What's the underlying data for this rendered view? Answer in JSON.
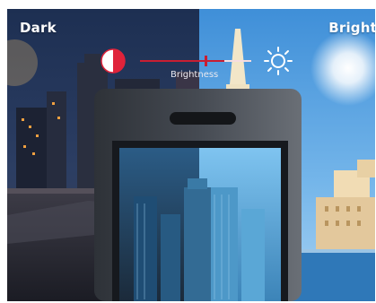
{
  "labels": {
    "dark": "Dark",
    "bright": "Bright",
    "brightness": "Brightness"
  },
  "brightness_slider": {
    "level_percent": 45
  },
  "icons": {
    "left": "contrast-half-circle-icon",
    "right": "sun-icon"
  },
  "colors": {
    "contrast_icon": "#e0233a",
    "slider_track": "#c81e32",
    "device_frame": "#3a3f46",
    "dark_sky": "#1e3050",
    "bright_sky": "#5aa7e6"
  }
}
